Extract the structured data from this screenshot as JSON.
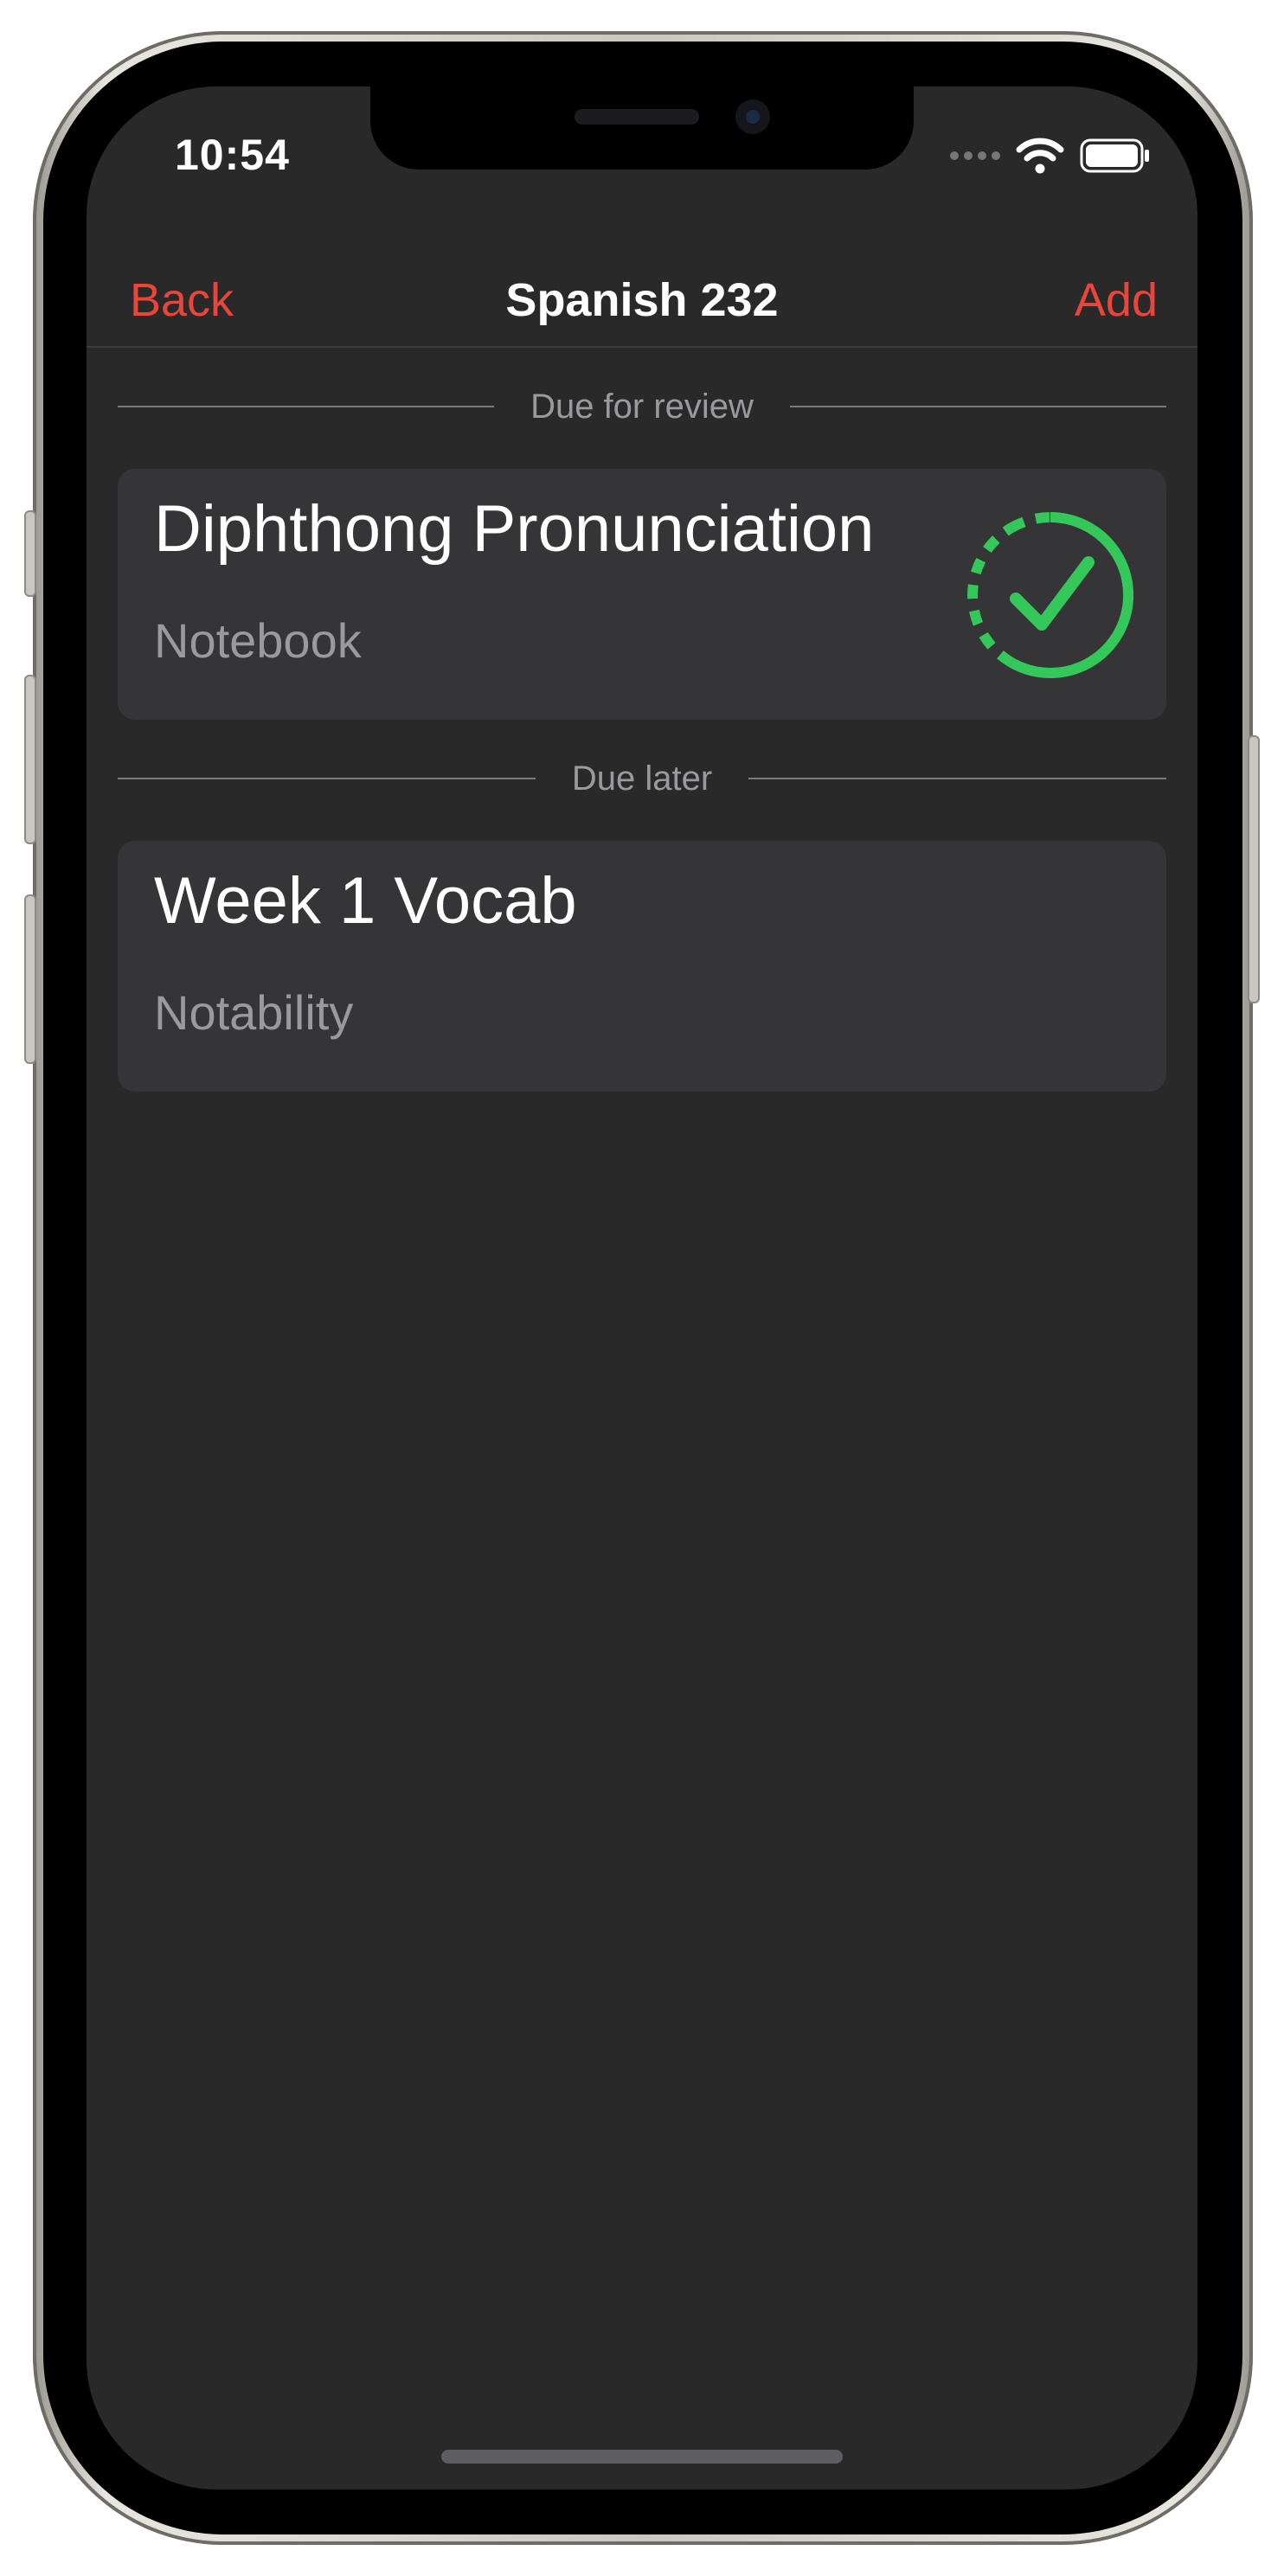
{
  "status_bar": {
    "time": "10:54"
  },
  "nav": {
    "back_label": "Back",
    "title": "Spanish 232",
    "add_label": "Add"
  },
  "sections": [
    {
      "header": "Due for review",
      "items": [
        {
          "title": "Diphthong Pronunciation",
          "subtitle": "Notebook",
          "status_icon": "dashed-circle-checkmark-icon",
          "status_color": "#34c759"
        }
      ]
    },
    {
      "header": "Due later",
      "items": [
        {
          "title": "Week 1 Vocab",
          "subtitle": "Notability"
        }
      ]
    }
  ],
  "colors": {
    "accent": "#e8463b",
    "background": "#2a292a",
    "card": "#353436",
    "success": "#34c759"
  }
}
